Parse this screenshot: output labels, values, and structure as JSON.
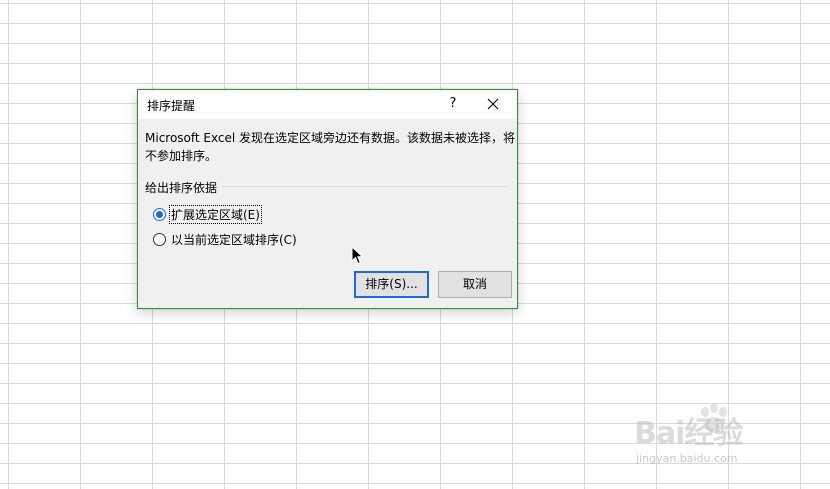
{
  "dialog": {
    "title": "排序提醒",
    "help_label": "?",
    "message": "Microsoft Excel 发现在选定区域旁边还有数据。该数据未被选择，将\n不参加排序。",
    "group_label": "给出排序依据",
    "options": [
      {
        "label": "扩展选定区域(E)",
        "checked": true
      },
      {
        "label": "以当前选定区域排序(C)",
        "checked": false
      }
    ],
    "sort_button": "排序(S)...",
    "cancel_button": "取消"
  },
  "watermark": {
    "logo": "Bai经验",
    "url": "jingyan.baidu.com"
  },
  "colors": {
    "dialog_border": "#3a8a3a",
    "accent": "#1a6ad8",
    "dialog_bg": "#f0f0f0",
    "grid_line": "#d9d9d9"
  },
  "icons": {
    "close": "close-icon",
    "help": "help-icon",
    "cursor": "mouse-pointer-icon",
    "watermark": "baidu-paw-icon"
  }
}
